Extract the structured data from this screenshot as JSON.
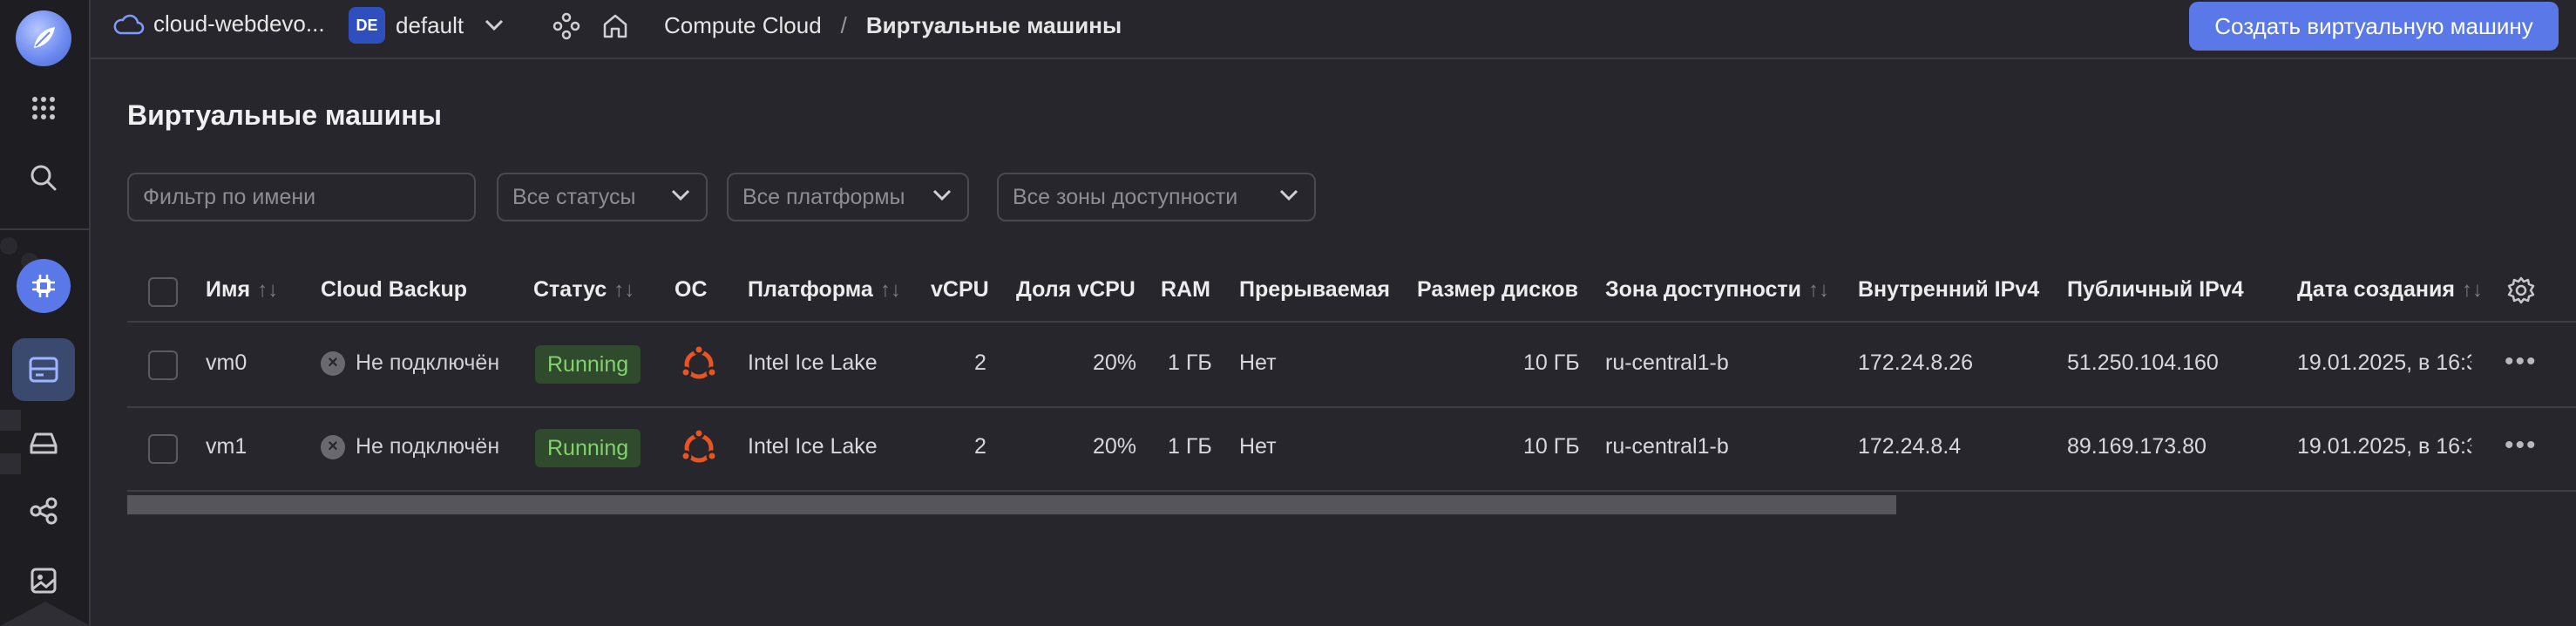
{
  "header": {
    "cloud_name": "cloud-webdevo...",
    "folder_badge": "DE",
    "folder_name": "default",
    "breadcrumb_service": "Compute Cloud",
    "breadcrumb_sep": "/",
    "breadcrumb_current": "Виртуальные машины",
    "create_button": "Создать виртуальную машину"
  },
  "page": {
    "title": "Виртуальные машины"
  },
  "filters": {
    "name_placeholder": "Фильтр по имени",
    "status": "Все статусы",
    "platform": "Все платформы",
    "zone": "Все зоны доступности"
  },
  "table": {
    "columns": {
      "name": "Имя",
      "backup": "Cloud Backup",
      "status": "Статус",
      "os": "ОС",
      "platform": "Платформа",
      "vcpu": "vCPU",
      "vcpu_share": "Доля vCPU",
      "ram": "RAM",
      "preemptible": "Прерываемая",
      "disk_size": "Размер дисков",
      "zone": "Зона доступности",
      "internal_ip": "Внутренний IPv4",
      "public_ip": "Публичный IPv4",
      "created": "Дата создания"
    },
    "sort_icon": "↑↓",
    "rows": [
      {
        "name": "vm0",
        "backup": "Не подключён",
        "status": "Running",
        "os": "ubuntu-icon",
        "platform": "Intel Ice Lake",
        "vcpu": "2",
        "vcpu_share": "20%",
        "ram": "1 ГБ",
        "preemptible": "Нет",
        "disk_size": "10 ГБ",
        "zone": "ru-central1-b",
        "internal_ip": "172.24.8.26",
        "public_ip": "51.250.104.160",
        "created": "19.01.2025, в 16:3"
      },
      {
        "name": "vm1",
        "backup": "Не подключён",
        "status": "Running",
        "os": "ubuntu-icon",
        "platform": "Intel Ice Lake",
        "vcpu": "2",
        "vcpu_share": "20%",
        "ram": "1 ГБ",
        "preemptible": "Нет",
        "disk_size": "10 ГБ",
        "zone": "ru-central1-b",
        "internal_ip": "172.24.8.4",
        "public_ip": "89.169.173.80",
        "created": "19.01.2025, в 16:3"
      }
    ]
  },
  "colors": {
    "background": "#27262c",
    "accent": "#5a78e8",
    "running_bg": "#2f4a2c",
    "running_text": "#7fd46a",
    "ubuntu": "#e95420"
  }
}
